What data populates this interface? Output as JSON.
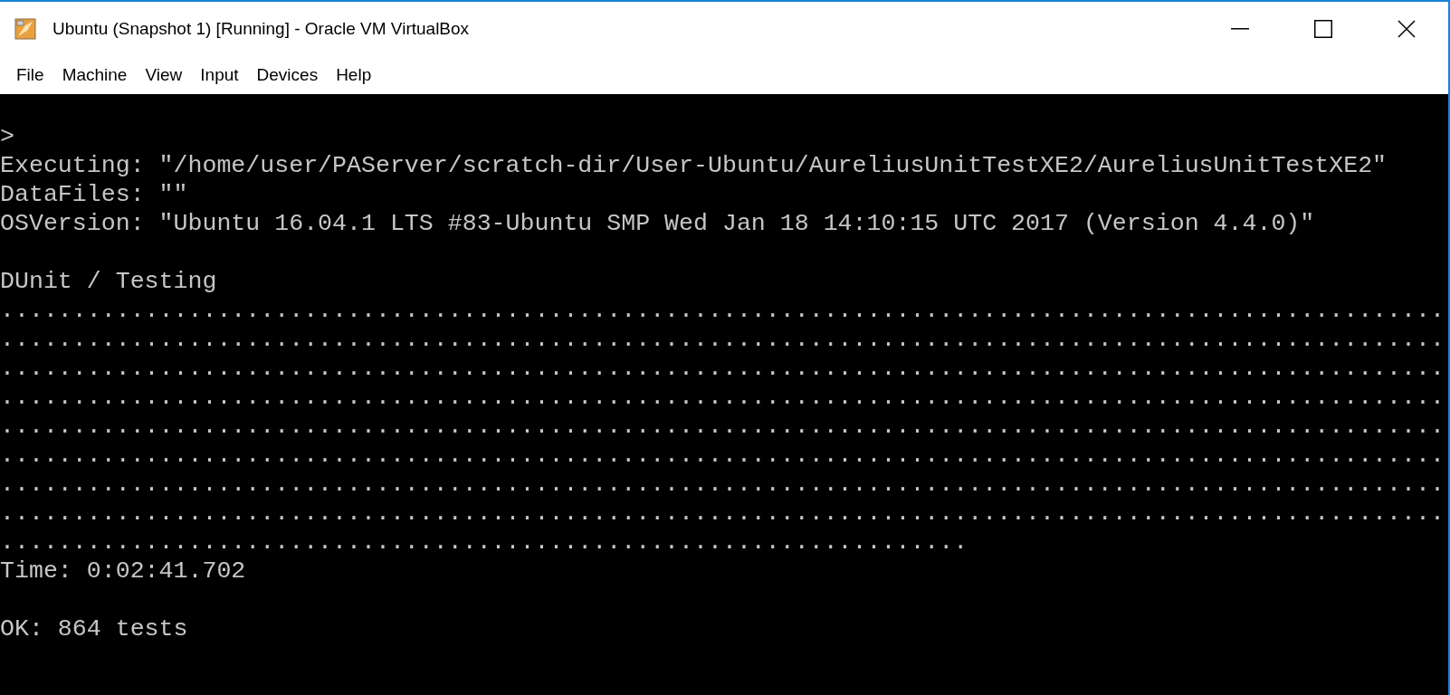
{
  "window": {
    "title": "Ubuntu (Snapshot 1) [Running] - Oracle VM VirtualBox"
  },
  "menu": [
    "File",
    "Machine",
    "View",
    "Input",
    "Devices",
    "Help"
  ],
  "console_blocks": [
    [
      ">",
      "Executing: \"/home/user/PAServer/scratch-dir/User-Ubuntu/AureliusUnitTestXE2/AureliusUnitTestXE2\"",
      "DataFiles: \"\"",
      "OSVersion: \"Ubuntu 16.04.1 LTS #83-Ubuntu SMP Wed Jan 18 14:10:15 UTC 2017 (Version 4.4.0)\""
    ],
    [
      "DUnit / Testing",
      "....................................................................................................",
      "....................................................................................................",
      "....................................................................................................",
      "....................................................................................................",
      "....................................................................................................",
      "....................................................................................................",
      "....................................................................................................",
      "....................................................................................................",
      "...................................................................",
      "Time: 0:02:41.702"
    ],
    [
      "OK: 864 tests"
    ]
  ]
}
